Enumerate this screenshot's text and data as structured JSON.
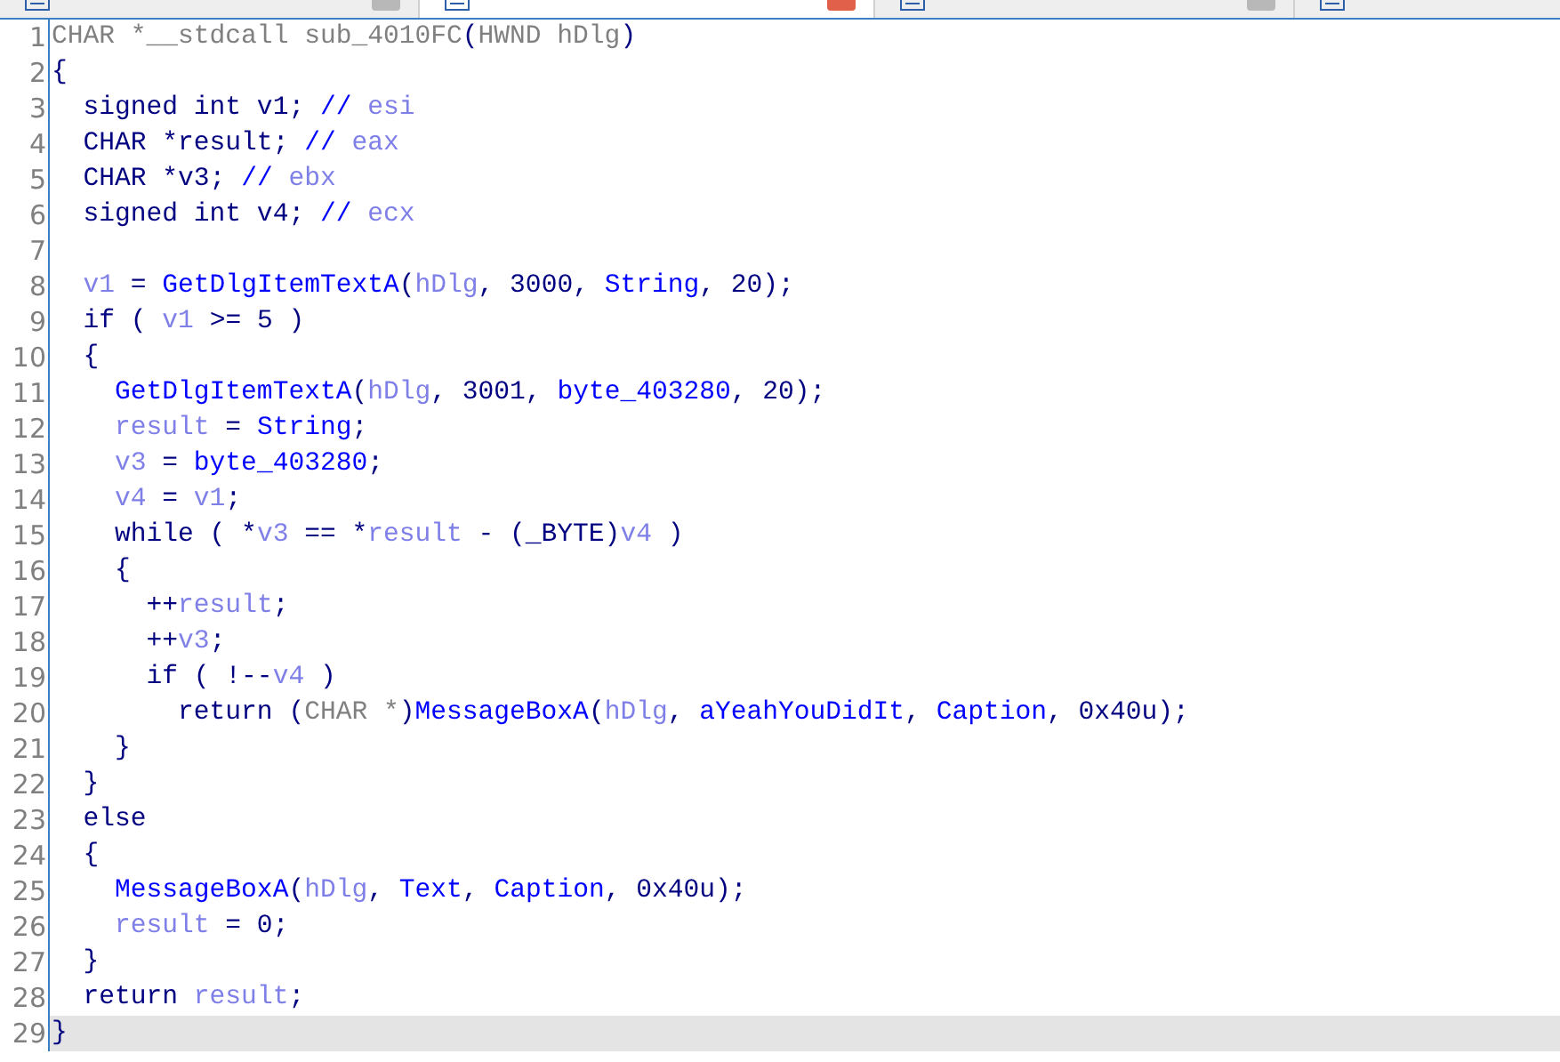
{
  "tabs": [
    {
      "selected": false
    },
    {
      "selected": true
    },
    {
      "selected": false
    },
    {
      "selected": false
    }
  ],
  "code": {
    "lines": [
      {
        "number": "1",
        "selected": false,
        "tokens": [
          {
            "kind": "dim",
            "text": "CHAR *__stdcall sub_4010FC"
          },
          {
            "kind": "plain",
            "text": "("
          },
          {
            "kind": "dim",
            "text": "HWND hDlg"
          },
          {
            "kind": "plain",
            "text": ")"
          }
        ]
      },
      {
        "number": "2",
        "selected": false,
        "tokens": [
          {
            "kind": "plain",
            "text": "{"
          }
        ]
      },
      {
        "number": "3",
        "selected": false,
        "tokens": [
          {
            "kind": "plain",
            "text": "  signed int v1; "
          },
          {
            "kind": "name",
            "text": "// "
          },
          {
            "kind": "var",
            "text": "esi"
          }
        ]
      },
      {
        "number": "4",
        "selected": false,
        "tokens": [
          {
            "kind": "plain",
            "text": "  CHAR *result; "
          },
          {
            "kind": "name",
            "text": "// "
          },
          {
            "kind": "var",
            "text": "eax"
          }
        ]
      },
      {
        "number": "5",
        "selected": false,
        "tokens": [
          {
            "kind": "plain",
            "text": "  CHAR *v3; "
          },
          {
            "kind": "name",
            "text": "// "
          },
          {
            "kind": "var",
            "text": "ebx"
          }
        ]
      },
      {
        "number": "6",
        "selected": false,
        "tokens": [
          {
            "kind": "plain",
            "text": "  signed int v4; "
          },
          {
            "kind": "name",
            "text": "// "
          },
          {
            "kind": "var",
            "text": "ecx"
          }
        ]
      },
      {
        "number": "7",
        "selected": false
      },
      {
        "number": "8",
        "selected": false,
        "tokens": [
          {
            "kind": "var",
            "text": "  v1"
          },
          {
            "kind": "plain",
            "text": " = "
          },
          {
            "kind": "name",
            "text": "GetDlgItemTextA"
          },
          {
            "kind": "plain",
            "text": "("
          },
          {
            "kind": "var",
            "text": "hDlg"
          },
          {
            "kind": "plain",
            "text": ", 3000, "
          },
          {
            "kind": "name",
            "text": "String"
          },
          {
            "kind": "plain",
            "text": ", 20);"
          }
        ]
      },
      {
        "number": "9",
        "selected": false,
        "tokens": [
          {
            "kind": "plain",
            "text": "  if ( "
          },
          {
            "kind": "var",
            "text": "v1"
          },
          {
            "kind": "plain",
            "text": " >= 5 )"
          }
        ]
      },
      {
        "number": "10",
        "selected": false,
        "tokens": [
          {
            "kind": "plain",
            "text": "  {"
          }
        ]
      },
      {
        "number": "11",
        "selected": false,
        "tokens": [
          {
            "kind": "name",
            "text": "    GetDlgItemTextA"
          },
          {
            "kind": "plain",
            "text": "("
          },
          {
            "kind": "var",
            "text": "hDlg"
          },
          {
            "kind": "plain",
            "text": ", 3001, "
          },
          {
            "kind": "name",
            "text": "byte_403280"
          },
          {
            "kind": "plain",
            "text": ", 20);"
          }
        ]
      },
      {
        "number": "12",
        "selected": false,
        "tokens": [
          {
            "kind": "var",
            "text": "    result"
          },
          {
            "kind": "plain",
            "text": " = "
          },
          {
            "kind": "name",
            "text": "String"
          },
          {
            "kind": "plain",
            "text": ";"
          }
        ]
      },
      {
        "number": "13",
        "selected": false,
        "tokens": [
          {
            "kind": "var",
            "text": "    v3"
          },
          {
            "kind": "plain",
            "text": " = "
          },
          {
            "kind": "name",
            "text": "byte_403280"
          },
          {
            "kind": "plain",
            "text": ";"
          }
        ]
      },
      {
        "number": "14",
        "selected": false,
        "tokens": [
          {
            "kind": "var",
            "text": "    v4"
          },
          {
            "kind": "plain",
            "text": " = "
          },
          {
            "kind": "var",
            "text": "v1"
          },
          {
            "kind": "plain",
            "text": ";"
          }
        ]
      },
      {
        "number": "15",
        "selected": false,
        "tokens": [
          {
            "kind": "plain",
            "text": "    while ( *"
          },
          {
            "kind": "var",
            "text": "v3"
          },
          {
            "kind": "plain",
            "text": " == *"
          },
          {
            "kind": "var",
            "text": "result"
          },
          {
            "kind": "plain",
            "text": " - (_BYTE)"
          },
          {
            "kind": "var",
            "text": "v4"
          },
          {
            "kind": "plain",
            "text": " )"
          }
        ]
      },
      {
        "number": "16",
        "selected": false,
        "tokens": [
          {
            "kind": "plain",
            "text": "    {"
          }
        ]
      },
      {
        "number": "17",
        "selected": false,
        "tokens": [
          {
            "kind": "plain",
            "text": "      ++"
          },
          {
            "kind": "var",
            "text": "result"
          },
          {
            "kind": "plain",
            "text": ";"
          }
        ]
      },
      {
        "number": "18",
        "selected": false,
        "tokens": [
          {
            "kind": "plain",
            "text": "      ++"
          },
          {
            "kind": "var",
            "text": "v3"
          },
          {
            "kind": "plain",
            "text": ";"
          }
        ]
      },
      {
        "number": "19",
        "selected": false,
        "tokens": [
          {
            "kind": "plain",
            "text": "      if ( !--"
          },
          {
            "kind": "var",
            "text": "v4"
          },
          {
            "kind": "plain",
            "text": " )"
          }
        ]
      },
      {
        "number": "20",
        "selected": false,
        "tokens": [
          {
            "kind": "plain",
            "text": "        return ("
          },
          {
            "kind": "dim",
            "text": "CHAR *"
          },
          {
            "kind": "plain",
            "text": ")"
          },
          {
            "kind": "name",
            "text": "MessageBoxA"
          },
          {
            "kind": "plain",
            "text": "("
          },
          {
            "kind": "var",
            "text": "hDlg"
          },
          {
            "kind": "plain",
            "text": ", "
          },
          {
            "kind": "name",
            "text": "aYeahYouDidIt"
          },
          {
            "kind": "plain",
            "text": ", "
          },
          {
            "kind": "name",
            "text": "Caption"
          },
          {
            "kind": "plain",
            "text": ", 0x40u);"
          }
        ]
      },
      {
        "number": "21",
        "selected": false,
        "tokens": [
          {
            "kind": "plain",
            "text": "    }"
          }
        ]
      },
      {
        "number": "22",
        "selected": false,
        "tokens": [
          {
            "kind": "plain",
            "text": "  }"
          }
        ]
      },
      {
        "number": "23",
        "selected": false,
        "tokens": [
          {
            "kind": "plain",
            "text": "  else"
          }
        ]
      },
      {
        "number": "24",
        "selected": false,
        "tokens": [
          {
            "kind": "plain",
            "text": "  {"
          }
        ]
      },
      {
        "number": "25",
        "selected": false,
        "tokens": [
          {
            "kind": "name",
            "text": "    MessageBoxA"
          },
          {
            "kind": "plain",
            "text": "("
          },
          {
            "kind": "var",
            "text": "hDlg"
          },
          {
            "kind": "plain",
            "text": ", "
          },
          {
            "kind": "name",
            "text": "Text"
          },
          {
            "kind": "plain",
            "text": ", "
          },
          {
            "kind": "name",
            "text": "Caption"
          },
          {
            "kind": "plain",
            "text": ", 0x40u);"
          }
        ]
      },
      {
        "number": "26",
        "selected": false,
        "tokens": [
          {
            "kind": "var",
            "text": "    result"
          },
          {
            "kind": "plain",
            "text": " = 0;"
          }
        ]
      },
      {
        "number": "27",
        "selected": false,
        "tokens": [
          {
            "kind": "plain",
            "text": "  }"
          }
        ]
      },
      {
        "number": "28",
        "selected": false,
        "tokens": [
          {
            "kind": "plain",
            "text": "  return "
          },
          {
            "kind": "var",
            "text": "result"
          },
          {
            "kind": "plain",
            "text": ";"
          }
        ]
      },
      {
        "number": "29",
        "selected": true,
        "tokens": [
          {
            "kind": "plain",
            "text": "}"
          }
        ]
      }
    ]
  }
}
